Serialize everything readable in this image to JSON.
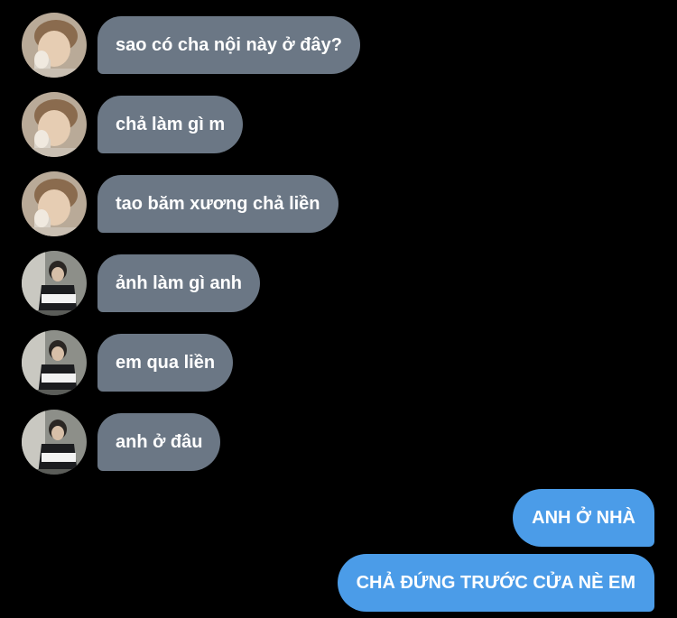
{
  "messages_in": [
    {
      "text": "sao có cha nội này ở đây?",
      "avatar": "avatar-a"
    },
    {
      "text": "chả làm gì m",
      "avatar": "avatar-a"
    },
    {
      "text": "tao băm xương chả liền",
      "avatar": "avatar-a"
    },
    {
      "text": "ảnh làm gì anh",
      "avatar": "avatar-b"
    },
    {
      "text": "em qua liền",
      "avatar": "avatar-b"
    },
    {
      "text": "anh ở đâu",
      "avatar": "avatar-b"
    }
  ],
  "messages_out": [
    {
      "text": "ANH Ở NHÀ"
    },
    {
      "text": "CHẢ ĐỨNG TRƯỚC CỬA NÈ EM"
    }
  ],
  "colors": {
    "background": "#000000",
    "incoming_bubble": "#6b7785",
    "outgoing_bubble": "#4b9ce8",
    "text": "#ffffff"
  }
}
